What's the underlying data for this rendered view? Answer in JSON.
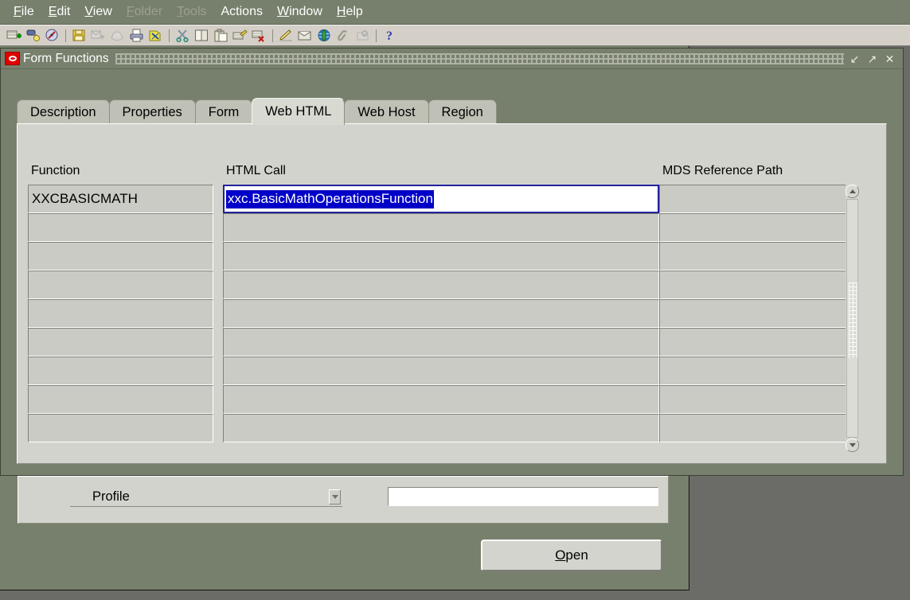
{
  "menubar": {
    "items": [
      {
        "label": "File",
        "mnemonic": "F",
        "enabled": true
      },
      {
        "label": "Edit",
        "mnemonic": "E",
        "enabled": true
      },
      {
        "label": "View",
        "mnemonic": "V",
        "enabled": true
      },
      {
        "label": "Folder",
        "mnemonic": "F",
        "enabled": false
      },
      {
        "label": "Tools",
        "mnemonic": "T",
        "enabled": false
      },
      {
        "label": "Actions",
        "mnemonic": "",
        "enabled": true
      },
      {
        "label": "Window",
        "mnemonic": "W",
        "enabled": true
      },
      {
        "label": "Help",
        "mnemonic": "H",
        "enabled": true
      }
    ]
  },
  "toolbar": {
    "buttons": [
      {
        "name": "new-icon",
        "enabled": true
      },
      {
        "name": "find-icon",
        "enabled": true
      },
      {
        "name": "show-navigator-icon",
        "enabled": true
      },
      {
        "name": "separator-1",
        "enabled": true
      },
      {
        "name": "save-icon",
        "enabled": true
      },
      {
        "name": "save-and-proceed-icon",
        "enabled": false
      },
      {
        "name": "next-step-icon",
        "enabled": false
      },
      {
        "name": "print-icon",
        "enabled": true
      },
      {
        "name": "close-form-icon",
        "enabled": true
      },
      {
        "name": "separator-2",
        "enabled": true
      },
      {
        "name": "cut-icon",
        "enabled": true
      },
      {
        "name": "copy-icon",
        "enabled": true
      },
      {
        "name": "paste-icon",
        "enabled": true
      },
      {
        "name": "clear-record-icon",
        "enabled": true
      },
      {
        "name": "delete-record-icon",
        "enabled": true
      },
      {
        "name": "separator-3",
        "enabled": true
      },
      {
        "name": "edit-field-icon",
        "enabled": true
      },
      {
        "name": "zoom-icon",
        "enabled": true
      },
      {
        "name": "translations-icon",
        "enabled": true
      },
      {
        "name": "attachments-icon",
        "enabled": true
      },
      {
        "name": "folder-tools-icon",
        "enabled": false
      },
      {
        "name": "separator-4",
        "enabled": true
      },
      {
        "name": "help-icon",
        "enabled": true
      }
    ]
  },
  "form_functions_window": {
    "title": "Form Functions",
    "window_buttons": [
      {
        "name": "minimize-button",
        "glyph": "↙"
      },
      {
        "name": "maximize-button",
        "glyph": "↗"
      },
      {
        "name": "close-button",
        "glyph": "✕"
      }
    ],
    "tabs": [
      {
        "label": "Description",
        "active": false
      },
      {
        "label": "Properties",
        "active": false
      },
      {
        "label": "Form",
        "active": false
      },
      {
        "label": "Web HTML",
        "active": true
      },
      {
        "label": "Web Host",
        "active": false
      },
      {
        "label": "Region",
        "active": false
      }
    ],
    "grid": {
      "columns": [
        {
          "key": "function",
          "header": "Function"
        },
        {
          "key": "html_call",
          "header": "HTML Call"
        },
        {
          "key": "mds_path",
          "header": "MDS Reference Path"
        }
      ],
      "rows": [
        {
          "function": "XXCBASICMATH",
          "html_call": "xxc.BasicMathOperationsFunction",
          "mds_path": "",
          "focused_field": "html_call",
          "selected": true
        },
        {
          "function": "",
          "html_call": "",
          "mds_path": ""
        },
        {
          "function": "",
          "html_call": "",
          "mds_path": ""
        },
        {
          "function": "",
          "html_call": "",
          "mds_path": ""
        },
        {
          "function": "",
          "html_call": "",
          "mds_path": ""
        },
        {
          "function": "",
          "html_call": "",
          "mds_path": ""
        },
        {
          "function": "",
          "html_call": "",
          "mds_path": ""
        },
        {
          "function": "",
          "html_call": "",
          "mds_path": ""
        },
        {
          "function": "",
          "html_call": "",
          "mds_path": ""
        }
      ],
      "scrollbar": {
        "up_glyph": "▲",
        "down_glyph": "▼"
      }
    }
  },
  "background_window": {
    "profile_combo": {
      "value": "Profile"
    },
    "text_field": {
      "value": "",
      "placeholder": ""
    },
    "open_button": {
      "label": "Open",
      "mnemonic": "O"
    }
  },
  "colors": {
    "app_background": "#77806c",
    "desktop": "#6b6b68",
    "panel": "#d3d3cd",
    "toolbar": "#d4d0c8",
    "selection_blue": "#0000c8",
    "focus_border": "#22229c",
    "titlebar_icon_red": "#e00000"
  }
}
